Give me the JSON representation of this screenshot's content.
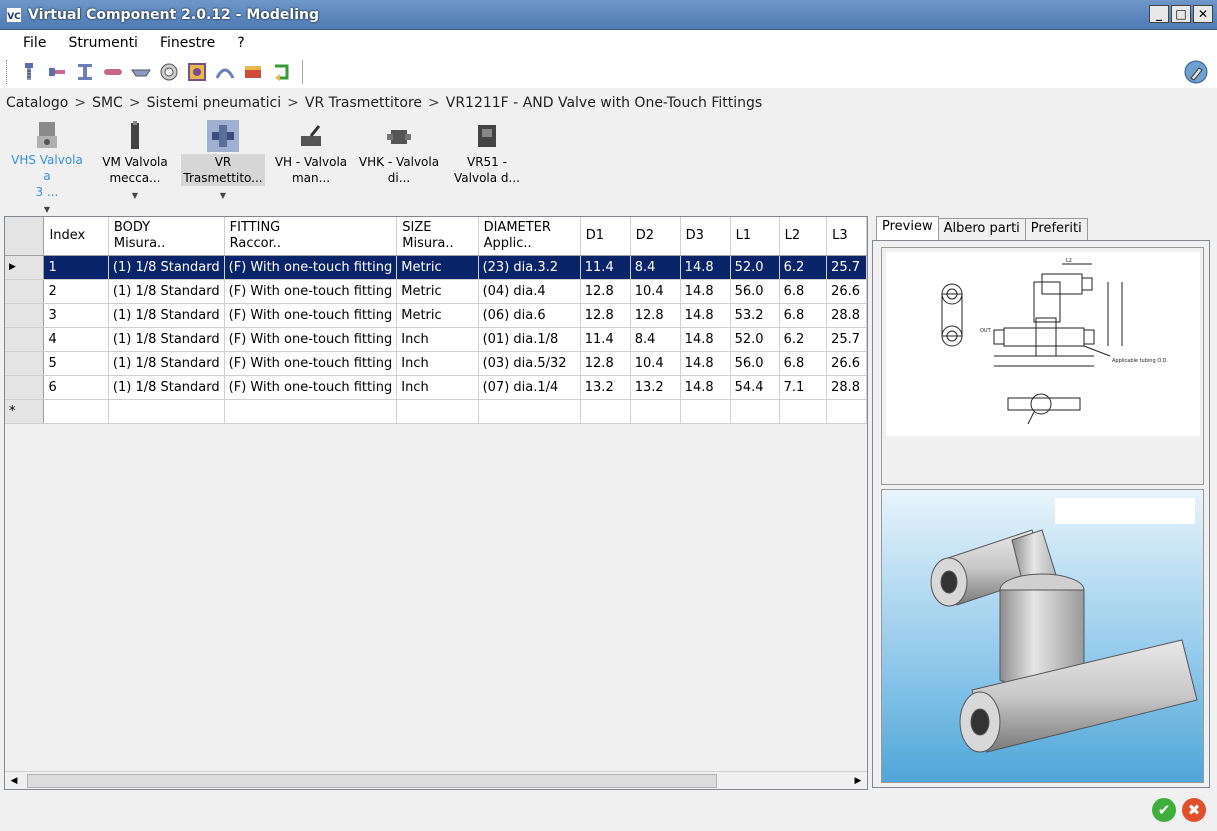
{
  "window": {
    "title": "Virtual Component 2.0.12 - Modeling"
  },
  "menu": [
    "File",
    "Strumenti",
    "Finestre",
    "?"
  ],
  "toolbar": {
    "icons": [
      "bolt-icon",
      "screw-icon",
      "beam-icon",
      "pin-icon",
      "washer-icon",
      "ring-icon",
      "bearing-icon",
      "clamp-icon",
      "profile-icon",
      "arrow-part-icon"
    ],
    "right_icon": "help-wizard-icon"
  },
  "breadcrumb": [
    "Catalogo",
    "SMC",
    "Sistemi pneumatici",
    "VR Trasmettitore",
    "VR1211F - AND Valve with One-Touch Fittings"
  ],
  "gallery": [
    {
      "line1": "VHS Valvola a",
      "line2": "3 ...",
      "state": "active",
      "dropdown": true
    },
    {
      "line1": "VM Valvola",
      "line2": "mecca...",
      "state": "normal",
      "dropdown": true
    },
    {
      "line1": "VR",
      "line2": "Trasmettito...",
      "state": "selected",
      "dropdown": true
    },
    {
      "line1": "VH - Valvola",
      "line2": "man...",
      "state": "normal",
      "dropdown": false
    },
    {
      "line1": "VHK - Valvola",
      "line2": "di...",
      "state": "normal",
      "dropdown": false
    },
    {
      "line1": "VR51 -",
      "line2": "Valvola d...",
      "state": "normal",
      "dropdown": false
    }
  ],
  "grid": {
    "columns": [
      {
        "l1": "Index",
        "l2": ""
      },
      {
        "l1": "BODY",
        "l2": "Misura.."
      },
      {
        "l1": "FITTING",
        "l2": "Raccor.."
      },
      {
        "l1": "SIZE",
        "l2": "Misura.."
      },
      {
        "l1": "DIAMETER",
        "l2": "Applic.."
      },
      {
        "l1": "D1",
        "l2": ""
      },
      {
        "l1": "D2",
        "l2": ""
      },
      {
        "l1": "D3",
        "l2": ""
      },
      {
        "l1": "L1",
        "l2": ""
      },
      {
        "l1": "L2",
        "l2": ""
      },
      {
        "l1": "L3",
        "l2": ""
      }
    ],
    "rows": [
      [
        "1",
        "(1) 1/8 Standard",
        "(F) With one-touch fitting",
        "Metric",
        "(23) dia.3.2",
        "11.4",
        "8.4",
        "14.8",
        "52.0",
        "6.2",
        "25.7"
      ],
      [
        "2",
        "(1) 1/8 Standard",
        "(F) With one-touch fitting",
        "Metric",
        "(04) dia.4",
        "12.8",
        "10.4",
        "14.8",
        "56.0",
        "6.8",
        "26.6"
      ],
      [
        "3",
        "(1) 1/8 Standard",
        "(F) With one-touch fitting",
        "Metric",
        "(06) dia.6",
        "12.8",
        "12.8",
        "14.8",
        "53.2",
        "6.8",
        "28.8"
      ],
      [
        "4",
        "(1) 1/8 Standard",
        "(F) With one-touch fitting",
        "Inch",
        "(01) dia.1/8",
        "11.4",
        "8.4",
        "14.8",
        "52.0",
        "6.2",
        "25.7"
      ],
      [
        "5",
        "(1) 1/8 Standard",
        "(F) With one-touch fitting",
        "Inch",
        "(03) dia.5/32",
        "12.8",
        "10.4",
        "14.8",
        "56.0",
        "6.8",
        "26.6"
      ],
      [
        "6",
        "(1) 1/8 Standard",
        "(F) With one-touch fitting",
        "Inch",
        "(07) dia.1/4",
        "13.2",
        "13.2",
        "14.8",
        "54.4",
        "7.1",
        "28.8"
      ]
    ],
    "selected_row": 0,
    "new_row_marker": "*"
  },
  "tabs": [
    "Preview",
    "Albero parti",
    "Preferiti"
  ],
  "active_tab": 0,
  "buttons": {
    "ok": "✔",
    "cancel": "✖"
  },
  "colors": {
    "selection": "#0a246a",
    "titlebar": "#5a86bd",
    "ok": "#3fae3a",
    "cancel": "#e0502a"
  }
}
